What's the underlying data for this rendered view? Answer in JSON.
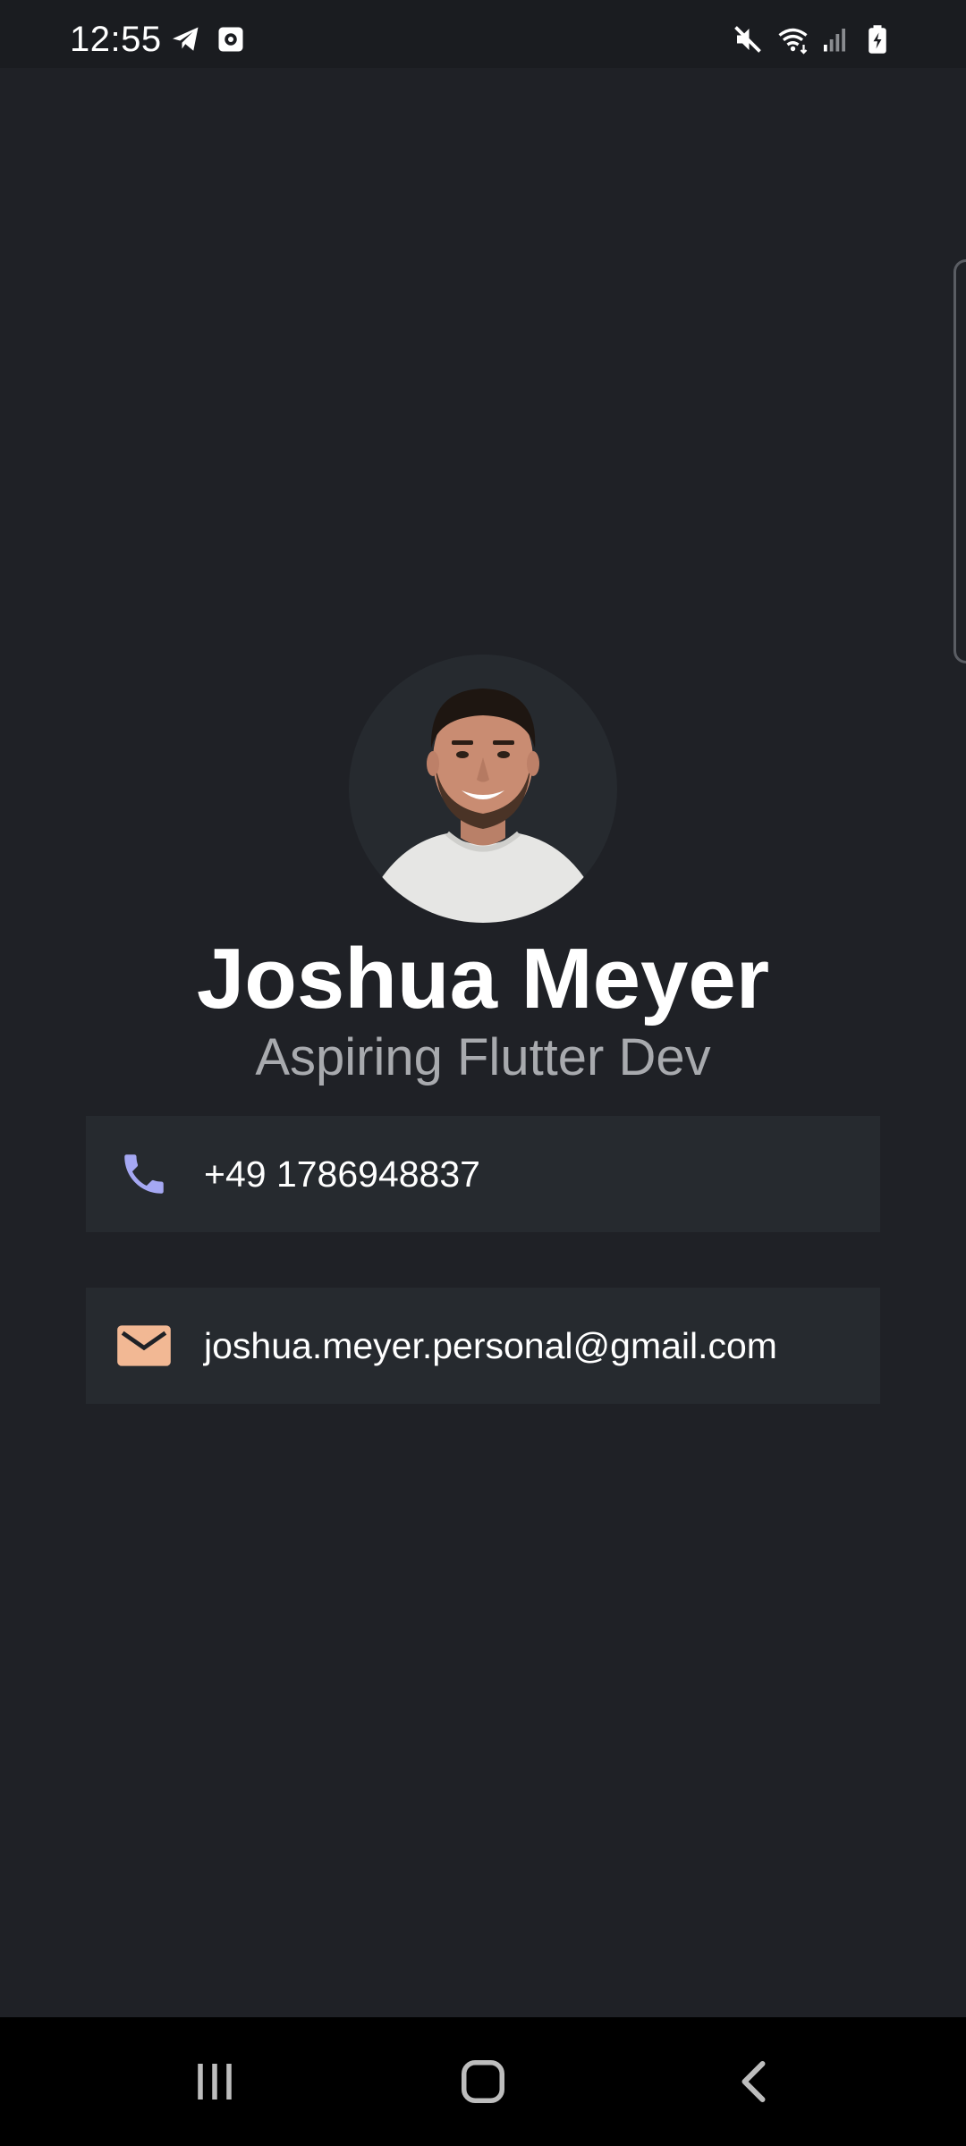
{
  "status_bar": {
    "time": "12:55",
    "left_icons": [
      "telegram-icon",
      "screenshot-icon"
    ],
    "right_icons": [
      "mute-icon",
      "wifi-icon",
      "signal-icon",
      "battery-charging-icon"
    ]
  },
  "profile": {
    "name": "Joshua Meyer",
    "subtitle": "Aspiring Flutter Dev",
    "avatar_icon": "profile-photo"
  },
  "contacts": {
    "phone": {
      "icon": "phone-icon",
      "value": "+49 1786948837",
      "icon_color": "#a5a8f3"
    },
    "email": {
      "icon": "mail-icon",
      "value": "joshua.meyer.personal@gmail.com",
      "icon_color": "#f2b894"
    }
  },
  "nav_bar": {
    "buttons": [
      "recent-apps-icon",
      "home-icon",
      "back-icon"
    ]
  },
  "colors": {
    "background": "#1f2126",
    "card": "#262a2f",
    "text_primary": "#ffffff",
    "text_secondary": "#a8aaae"
  }
}
